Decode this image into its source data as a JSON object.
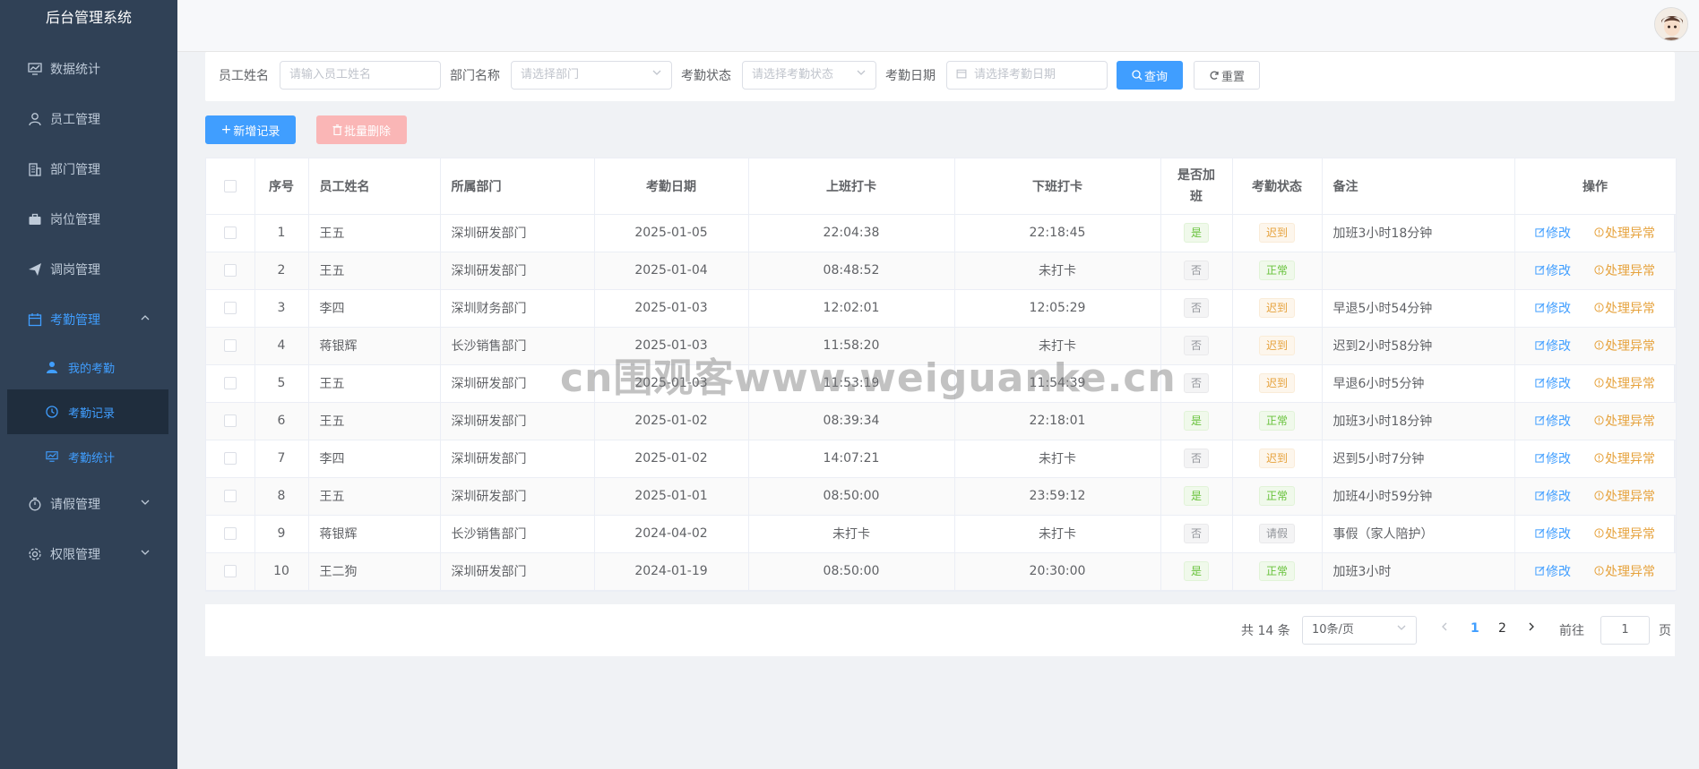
{
  "app": {
    "title": "后台管理系统"
  },
  "sidebar": {
    "items": [
      {
        "label": "数据统计",
        "icon": "chart-icon"
      },
      {
        "label": "员工管理",
        "icon": "user-icon"
      },
      {
        "label": "部门管理",
        "icon": "building-icon"
      },
      {
        "label": "岗位管理",
        "icon": "briefcase-icon"
      },
      {
        "label": "调岗管理",
        "icon": "send-icon"
      },
      {
        "label": "考勤管理",
        "icon": "calendar-icon",
        "expanded": true
      },
      {
        "label": "请假管理",
        "icon": "timer-icon"
      },
      {
        "label": "权限管理",
        "icon": "gear-icon"
      }
    ],
    "subitems": [
      {
        "label": "我的考勤",
        "icon": "person-icon"
      },
      {
        "label": "考勤记录",
        "icon": "clock-icon",
        "current": true
      },
      {
        "label": "考勤统计",
        "icon": "chart-icon"
      }
    ]
  },
  "search": {
    "name_label": "员工姓名",
    "name_placeholder": "请输入员工姓名",
    "dept_label": "部门名称",
    "dept_placeholder": "请选择部门",
    "status_label": "考勤状态",
    "status_placeholder": "请选择考勤状态",
    "date_label": "考勤日期",
    "date_placeholder": "请选择考勤日期",
    "query_btn": "查询",
    "reset_btn": "重置"
  },
  "toolbar": {
    "add_btn": "新增记录",
    "batch_delete_btn": "批量删除"
  },
  "table": {
    "headers": {
      "index": "序号",
      "name": "员工姓名",
      "dept": "所属部门",
      "date": "考勤日期",
      "checkin": "上班打卡",
      "checkout": "下班打卡",
      "overtime": "是否加班",
      "status": "考勤状态",
      "remark": "备注",
      "ops": "操作"
    },
    "op_edit": "修改",
    "op_abnormal": "处理异常",
    "rows": [
      {
        "index": "1",
        "name": "王五",
        "dept": "深圳研发部门",
        "date": "2025-01-05",
        "checkin": "22:04:38",
        "checkout": "22:18:45",
        "overtime": "是",
        "status": "迟到",
        "remark": "加班3小时18分钟"
      },
      {
        "index": "2",
        "name": "王五",
        "dept": "深圳研发部门",
        "date": "2025-01-04",
        "checkin": "08:48:52",
        "checkout": "未打卡",
        "overtime": "否",
        "status": "正常",
        "remark": ""
      },
      {
        "index": "3",
        "name": "李四",
        "dept": "深圳财务部门",
        "date": "2025-01-03",
        "checkin": "12:02:01",
        "checkout": "12:05:29",
        "overtime": "否",
        "status": "迟到",
        "remark": "早退5小时54分钟"
      },
      {
        "index": "4",
        "name": "蒋银辉",
        "dept": "长沙销售部门",
        "date": "2025-01-03",
        "checkin": "11:58:20",
        "checkout": "未打卡",
        "overtime": "否",
        "status": "迟到",
        "remark": "迟到2小时58分钟"
      },
      {
        "index": "5",
        "name": "王五",
        "dept": "深圳研发部门",
        "date": "2025-01-03",
        "checkin": "11:53:19",
        "checkout": "11:54:39",
        "overtime": "否",
        "status": "迟到",
        "remark": "早退6小时5分钟"
      },
      {
        "index": "6",
        "name": "王五",
        "dept": "深圳研发部门",
        "date": "2025-01-02",
        "checkin": "08:39:34",
        "checkout": "22:18:01",
        "overtime": "是",
        "status": "正常",
        "remark": "加班3小时18分钟"
      },
      {
        "index": "7",
        "name": "李四",
        "dept": "深圳研发部门",
        "date": "2025-01-02",
        "checkin": "14:07:21",
        "checkout": "未打卡",
        "overtime": "否",
        "status": "迟到",
        "remark": "迟到5小时7分钟"
      },
      {
        "index": "8",
        "name": "王五",
        "dept": "深圳研发部门",
        "date": "2025-01-01",
        "checkin": "08:50:00",
        "checkout": "23:59:12",
        "overtime": "是",
        "status": "正常",
        "remark": "加班4小时59分钟"
      },
      {
        "index": "9",
        "name": "蒋银辉",
        "dept": "长沙销售部门",
        "date": "2024-04-02",
        "checkin": "未打卡",
        "checkout": "未打卡",
        "overtime": "否",
        "status": "请假",
        "remark": "事假（家人陪护）"
      },
      {
        "index": "10",
        "name": "王二狗",
        "dept": "深圳研发部门",
        "date": "2024-01-19",
        "checkin": "08:50:00",
        "checkout": "20:30:00",
        "overtime": "是",
        "status": "正常",
        "remark": "加班3小时"
      }
    ]
  },
  "pagination": {
    "total_text": "共 14 条",
    "page_size": "10条/页",
    "pages": [
      "1",
      "2"
    ],
    "current_page": "1",
    "goto_prefix": "前往",
    "goto_value": "1",
    "goto_suffix": "页"
  },
  "watermark": "cn围观客www.weiguanke.cn",
  "colors": {
    "primary": "#409eff",
    "sidebar_bg": "#304156",
    "success": "#67c23a",
    "warning": "#e6a23c",
    "info": "#909399",
    "danger_light": "#fab6b6"
  }
}
